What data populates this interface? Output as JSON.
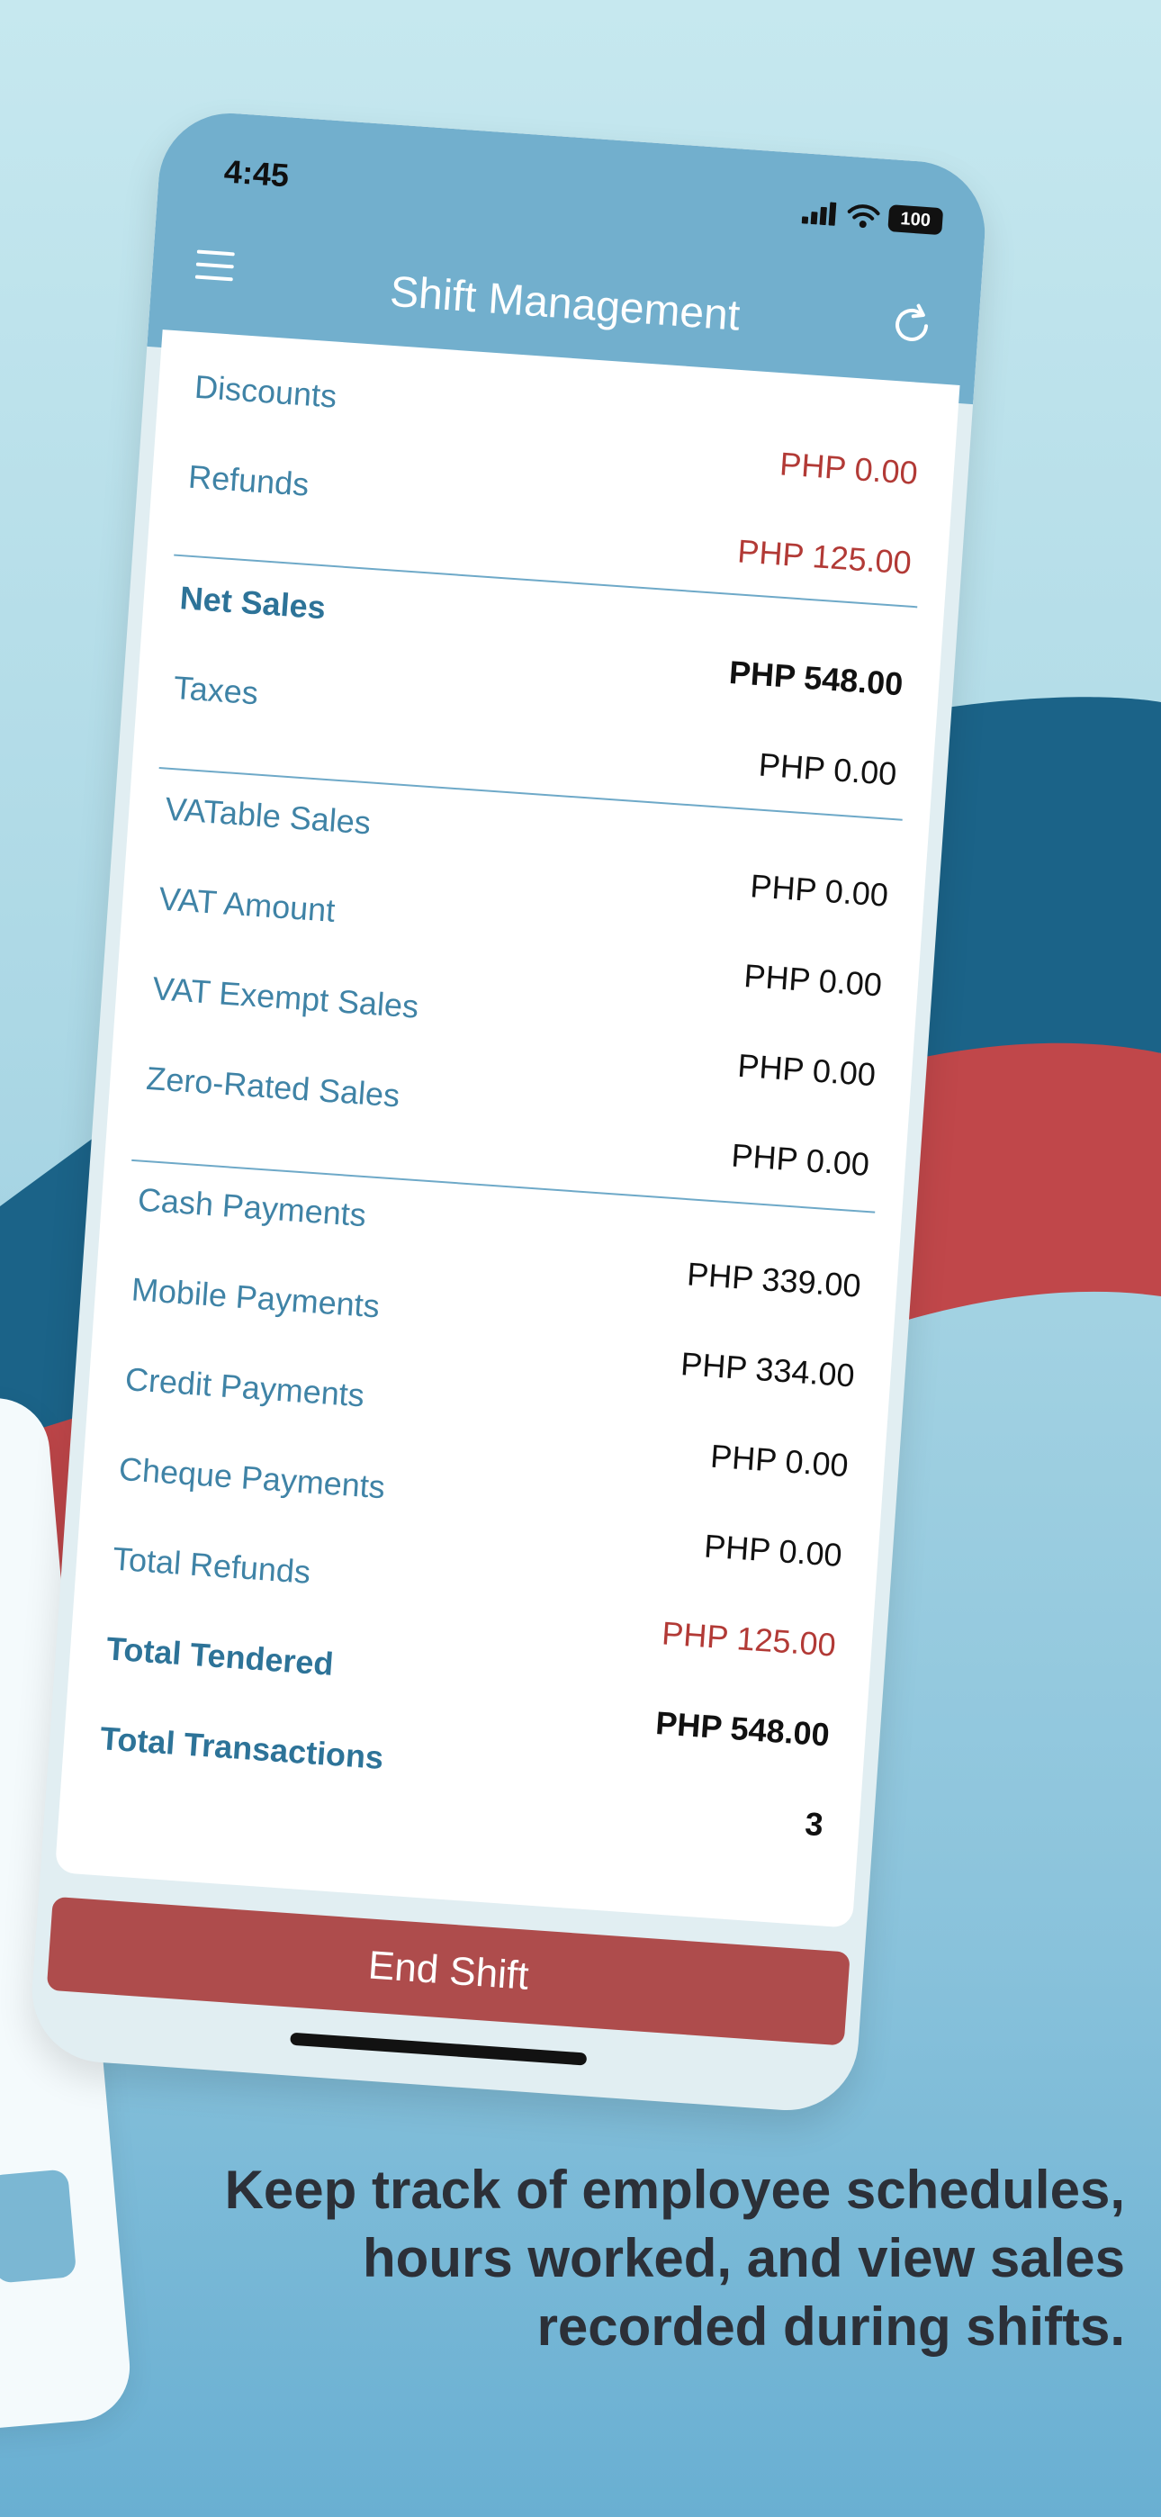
{
  "status_bar": {
    "time": "4:45",
    "battery": "100"
  },
  "header": {
    "title": "Shift Management"
  },
  "summary": {
    "discounts": {
      "label": "Discounts",
      "value": "PHP 0.00"
    },
    "refunds": {
      "label": "Refunds",
      "value": "PHP 125.00"
    },
    "net_sales": {
      "label": "Net Sales",
      "value": "PHP 548.00"
    },
    "taxes": {
      "label": "Taxes",
      "value": "PHP 0.00"
    },
    "vatable_sales": {
      "label": "VATable Sales",
      "value": "PHP 0.00"
    },
    "vat_amount": {
      "label": "VAT Amount",
      "value": "PHP 0.00"
    },
    "vat_exempt_sales": {
      "label": "VAT Exempt Sales",
      "value": "PHP 0.00"
    },
    "zero_rated_sales": {
      "label": "Zero-Rated Sales",
      "value": "PHP 0.00"
    },
    "cash_payments": {
      "label": "Cash Payments",
      "value": "PHP 339.00"
    },
    "mobile_payments": {
      "label": "Mobile Payments",
      "value": "PHP 334.00"
    },
    "credit_payments": {
      "label": "Credit Payments",
      "value": "PHP 0.00"
    },
    "cheque_payments": {
      "label": "Cheque Payments",
      "value": "PHP 0.00"
    },
    "total_refunds": {
      "label": "Total Refunds",
      "value": "PHP 125.00"
    },
    "total_tendered": {
      "label": "Total Tendered",
      "value": "PHP 548.00"
    },
    "total_transactions": {
      "label": "Total Transactions",
      "value": "3"
    }
  },
  "actions": {
    "end_shift": "End Shift"
  },
  "caption": {
    "line1": "Keep track of employee schedules,",
    "line2": "hours worked, and view sales",
    "line3": "recorded during shifts."
  },
  "colors": {
    "header": "#72afcd",
    "label": "#3f83a6",
    "negative": "#b23a36",
    "end_shift": "#ae4c4c",
    "wave_blue": "#1b6388",
    "wave_red": "#c0474a"
  }
}
